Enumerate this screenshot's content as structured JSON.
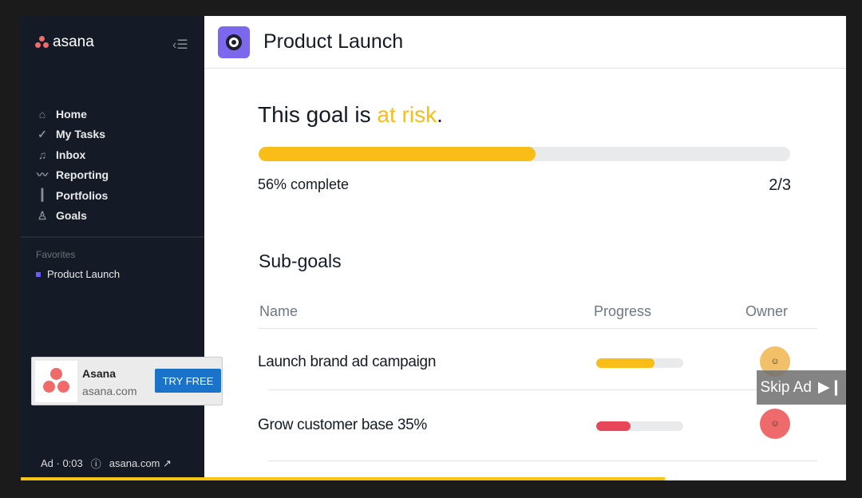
{
  "sidebar": {
    "logo_text": "asana",
    "nav": [
      {
        "label": "Home",
        "icon": "home-icon"
      },
      {
        "label": "My Tasks",
        "icon": "check-circle-icon"
      },
      {
        "label": "Inbox",
        "icon": "bell-icon"
      },
      {
        "label": "Reporting",
        "icon": "chart-line-icon"
      },
      {
        "label": "Portfolios",
        "icon": "bars-icon"
      },
      {
        "label": "Goals",
        "icon": "person-icon"
      }
    ],
    "favorites_title": "Favorites",
    "favorites": [
      {
        "label": "Product Launch",
        "color": "#6b5cf6"
      }
    ]
  },
  "header": {
    "title": "Product Launch"
  },
  "goal": {
    "prefix": "This goal is ",
    "status": "at risk",
    "suffix": ".",
    "progress_percent": 56,
    "progress_label": "56% complete",
    "count": "2/3",
    "status_color": "#f8bd16"
  },
  "subgoals": {
    "title": "Sub-goals",
    "columns": [
      "Name",
      "Progress",
      "Owner"
    ],
    "rows": [
      {
        "name": "Launch brand ad campaign",
        "progress_percent": 67,
        "color": "#f8bd16",
        "owner_bg": "#f2c068"
      },
      {
        "name": "Grow customer base 35%",
        "progress_percent": 39,
        "color": "#e8475a",
        "owner_bg": "#ef6b6b"
      }
    ]
  },
  "ad": {
    "advertiser": "Asana",
    "url": "asana.com",
    "cta": "TRY FREE",
    "info": "Ad · 0:03",
    "footer_url": "asana.com",
    "skip_label": "Skip Ad",
    "video_progress_percent": 78
  }
}
